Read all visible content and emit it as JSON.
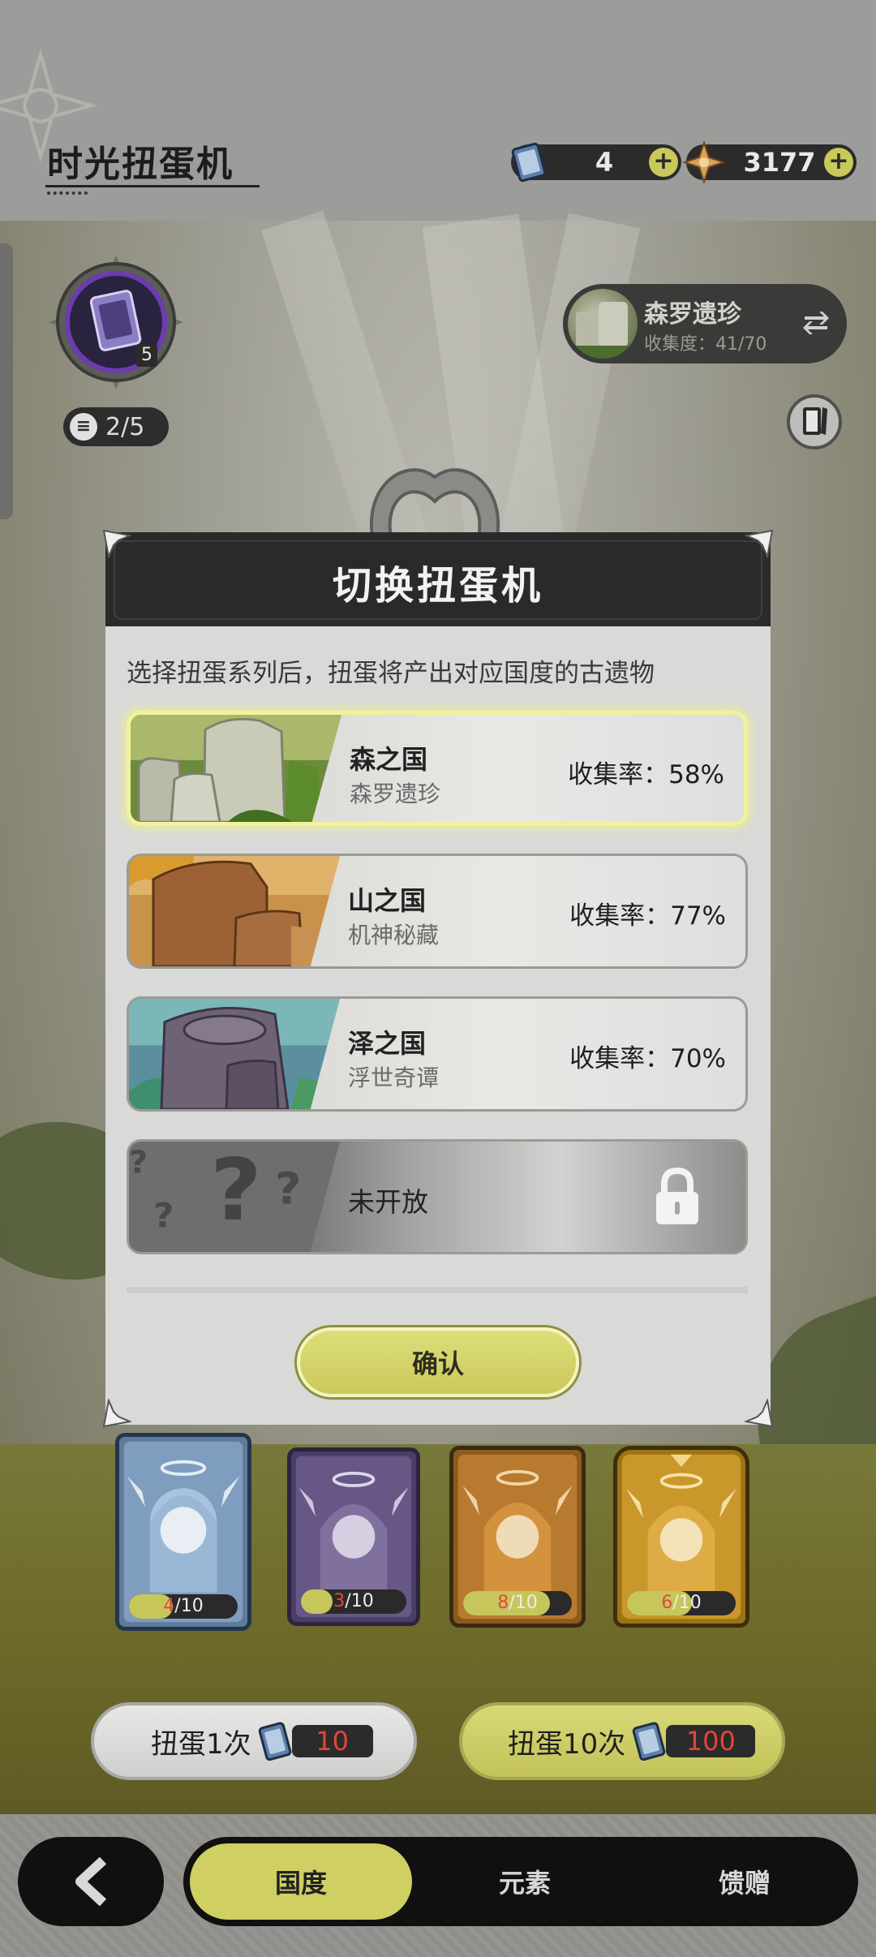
{
  "header": {
    "title": "时光扭蛋机"
  },
  "currencies": [
    {
      "name": "ticket",
      "value": "4",
      "icon": "ticket-icon"
    },
    {
      "name": "gem",
      "value": "3177",
      "icon": "gem-icon"
    }
  ],
  "level": {
    "badge_number": "5",
    "count": "2/5"
  },
  "current_series": {
    "name": "森罗遗珍",
    "collection": "收集度：41/70"
  },
  "modal": {
    "title": "切换扭蛋机",
    "description": "选择扭蛋系列后，扭蛋将产出对应国度的古遗物",
    "options": [
      {
        "country": "森之国",
        "series": "森罗遗珍",
        "rate": "收集率：58%",
        "selected": true
      },
      {
        "country": "山之国",
        "series": "机神秘藏",
        "rate": "收集率：77%",
        "selected": false
      },
      {
        "country": "泽之国",
        "series": "浮世奇谭",
        "rate": "收集率：70%",
        "selected": false
      }
    ],
    "locked": {
      "label": "未开放"
    },
    "confirm_label": "确认"
  },
  "cards": [
    {
      "current": "4",
      "total": "/10",
      "progress": 0.4
    },
    {
      "current": "3",
      "total": "/10",
      "progress": 0.3
    },
    {
      "current": "8",
      "total": "/10",
      "progress": 0.8
    },
    {
      "current": "6",
      "total": "/10",
      "progress": 0.6
    }
  ],
  "draw": {
    "single_label": "扭蛋1次",
    "single_cost": "10",
    "multi_label": "扭蛋10次",
    "multi_cost": "100"
  },
  "nav": {
    "tabs": [
      {
        "label": "国度",
        "active": true
      },
      {
        "label": "元素",
        "active": false
      },
      {
        "label": "馈赠",
        "active": false
      }
    ]
  },
  "colors": {
    "accent": "#cfcf63",
    "cost_text": "#e34538",
    "dark": "#101010"
  }
}
